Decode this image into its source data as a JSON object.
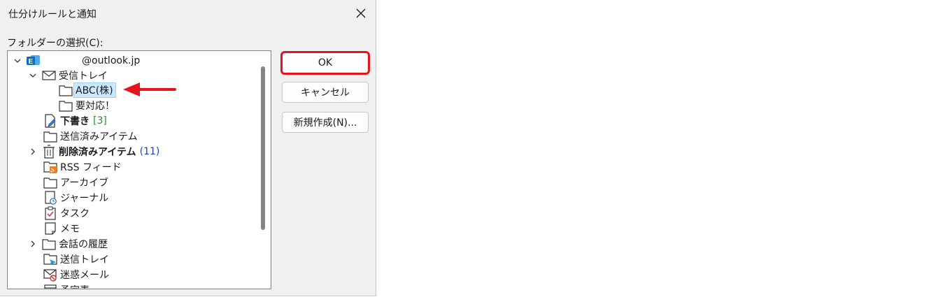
{
  "dialog": {
    "title": "仕分けルールと通知",
    "close_symbol": "✕",
    "folder_label": "フォルダーの選択(C):"
  },
  "tree": {
    "account": "@outlook.jp",
    "inbox": "受信トレイ",
    "abc": "ABC(株)",
    "taiou": "要対応！",
    "drafts": "下書き",
    "drafts_count": "[3]",
    "sent": "送信済みアイテム",
    "deleted": "削除済みアイテム",
    "deleted_count": "(11)",
    "rss": "RSS フィード",
    "archive": "アーカイブ",
    "journal": "ジャーナル",
    "tasks": "タスク",
    "notes": "メモ",
    "conversation": "会話の履歴",
    "outbox": "送信トレイ",
    "junk": "迷惑メール",
    "cutoff": "予定表"
  },
  "buttons": {
    "ok": "OK",
    "cancel": "キャンセル",
    "new": "新規作成(N)..."
  },
  "colors": {
    "highlight": "#e8141c",
    "selection": "#cce8ff",
    "count_green": "#2e8b2e",
    "count_blue": "#1f3cc9",
    "outlook_blue": "#0f6cbd"
  }
}
